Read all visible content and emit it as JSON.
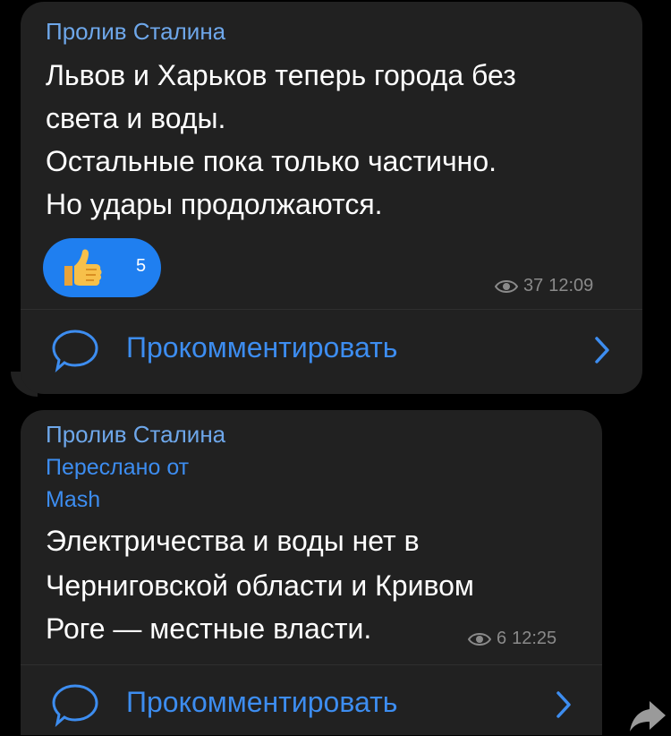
{
  "messages": [
    {
      "sender": "Пролив Сталина",
      "lines": [
        "Львов и Харьков теперь города без",
        "света и воды.",
        "Остальные пока только частично.",
        "Но удары продолжаются."
      ],
      "reaction": {
        "icon": "thumbs-up-icon",
        "count": "5"
      },
      "views": "37",
      "time": "12:09",
      "comment_label": "Прокомментировать"
    },
    {
      "sender": "Пролив Сталина",
      "forwarded_label": "Переслано от",
      "forwarded_from": "Mash",
      "lines": [
        "Электричества и воды нет в",
        "Черниговской области и Кривом",
        "Роге — местные власти."
      ],
      "views": "6",
      "time": "12:25",
      "comment_label": "Прокомментировать"
    }
  ],
  "colors": {
    "background": "#000000",
    "bubble": "#212121",
    "accent": "#3d8df0",
    "sender": "#6ea7ea",
    "reaction": "#1f7ff0",
    "meta": "#8a8a8a"
  }
}
